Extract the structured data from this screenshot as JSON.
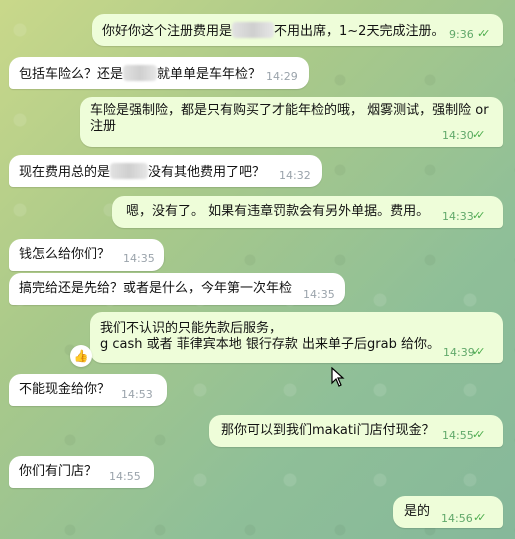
{
  "messages": [
    {
      "parts": [
        "你好你这个注册费用是",
        "不用出席，1~2天完成注册。"
      ],
      "time": "9:36"
    },
    {
      "parts": [
        "包括车险么？还是",
        "就单单是车年检？"
      ],
      "time": "14:29"
    },
    {
      "line1": "车险是强制险，都是只有购买了才能年检的哦， 烟雾测试，强制险 or",
      "line2": "注册",
      "time": "14:30"
    },
    {
      "parts": [
        "现在费用总的是",
        "没有其他费用了吧？"
      ],
      "time": "14:32"
    },
    {
      "text": "嗯，没有了。 如果有违章罚款会有另外单据。费用。",
      "time": "14:33"
    },
    {
      "text": "钱怎么给你们？",
      "time": "14:35"
    },
    {
      "text": "搞完给还是先给？或者是什么，今年第一次年检",
      "time": "14:35"
    },
    {
      "line1": "我们不认识的只能先款后服务，",
      "line2": "g cash 或者 菲律宾本地 银行存款  出来单子后grab 给你。",
      "time": "14:39",
      "reaction": "👍"
    },
    {
      "text": "不能现金给你？",
      "time": "14:53"
    },
    {
      "text": "那你可以到我们makati门店付现金？",
      "time": "14:55"
    },
    {
      "text": "你们有门店？",
      "time": "14:55"
    },
    {
      "text": "是的",
      "time": "14:56"
    }
  ],
  "read_mark": "✓✓",
  "colors": {
    "incoming": "#ffffff",
    "outgoing": "#eefdd9",
    "check": "#4fae4e"
  }
}
